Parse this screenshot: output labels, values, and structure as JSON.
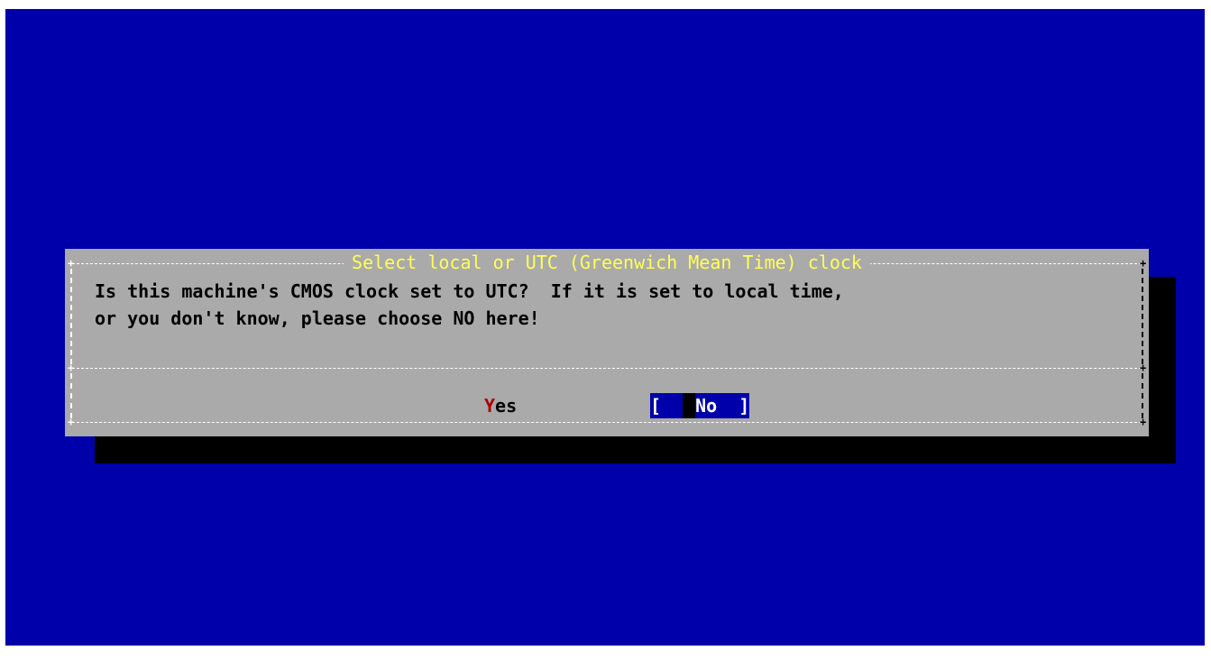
{
  "dialog": {
    "title": "Select local or UTC (Greenwich Mean Time) clock",
    "message_line1": "Is this machine's CMOS clock set to UTC?  If it is set to local time,",
    "message_line2": "or you don't know, please choose NO here!"
  },
  "buttons": {
    "yes_hotkey": "Y",
    "yes_rest": "es",
    "no_open": "[  ",
    "no_hotkey": "N",
    "no_rest": "o  ]",
    "selected": "No"
  },
  "colors": {
    "background": "#0000aa",
    "dialog": "#aaaaaa",
    "title": "#ffff55",
    "hotkey": "#aa0000",
    "selected_button": "#0000aa",
    "shadow": "#000000"
  }
}
